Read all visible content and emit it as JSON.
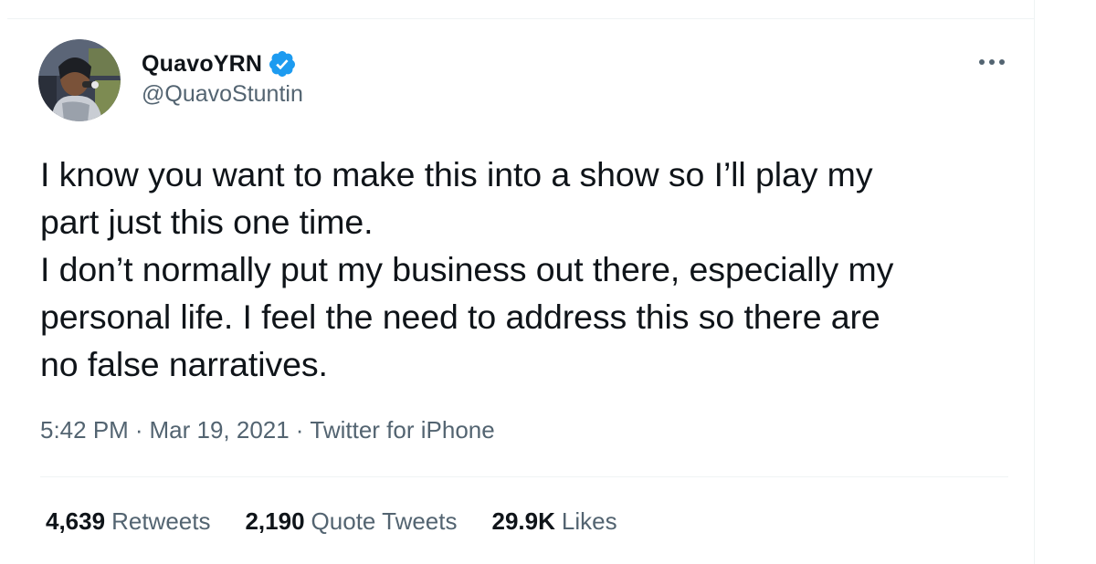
{
  "tweet": {
    "author": {
      "display_name": "QuavoYRN",
      "handle": "@QuavoStuntin",
      "verified": true,
      "avatar_icon": "profile-photo"
    },
    "text": "I know you want to make this into a show so I’ll play my\npart just this one time.\nI don’t normally put my business out there, especially my\npersonal life. I feel the need to address this so there are\nno false narratives.",
    "meta": {
      "time": "5:42 PM",
      "separator": "·",
      "date": "Mar 19, 2021",
      "source": "Twitter for iPhone"
    },
    "stats": {
      "retweets": {
        "count": "4,639",
        "label": "Retweets"
      },
      "quote_tweets": {
        "count": "2,190",
        "label": "Quote Tweets"
      },
      "likes": {
        "count": "29.9K",
        "label": "Likes"
      }
    }
  },
  "colors": {
    "text_primary": "#0f1419",
    "text_secondary": "#536471",
    "verified_blue": "#1d9bf0",
    "divider": "#eff3f4"
  },
  "icons": {
    "more": "more-horizontal-icon",
    "verified": "verified-badge-icon"
  }
}
